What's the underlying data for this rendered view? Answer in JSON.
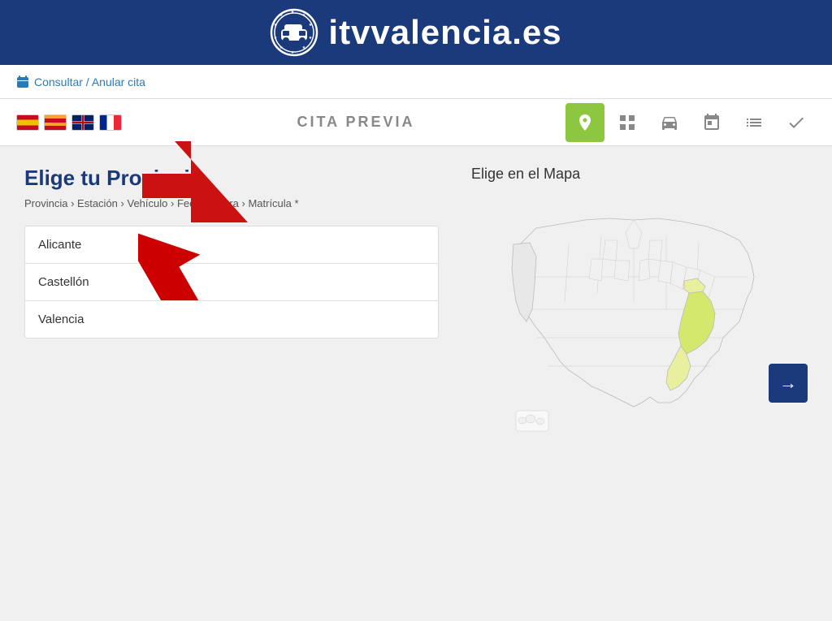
{
  "header": {
    "title": "itvvalencia.es",
    "logo_alt": "ITV car logo"
  },
  "topbar": {
    "link_text": "Consultar / Anular cita"
  },
  "navbar": {
    "title": "CITA PREVIA",
    "flags": [
      {
        "code": "es",
        "label": "Español"
      },
      {
        "code": "ca",
        "label": "Valenciano"
      },
      {
        "code": "uk",
        "label": "English"
      },
      {
        "code": "fr",
        "label": "Français"
      }
    ],
    "icons": [
      {
        "name": "location",
        "active": true
      },
      {
        "name": "grid"
      },
      {
        "name": "car"
      },
      {
        "name": "calendar"
      },
      {
        "name": "list"
      },
      {
        "name": "check"
      }
    ]
  },
  "main": {
    "title": "Elige tu Provincia",
    "breadcrumb": {
      "items": [
        "Provincia",
        "Estación",
        "Vehículo",
        "Fecha",
        "Hora",
        "Matrícula *"
      ],
      "separators": [
        ">",
        ">",
        ">",
        ">",
        ">"
      ]
    },
    "provinces": [
      {
        "name": "Alicante"
      },
      {
        "name": "Castellón"
      },
      {
        "name": "Valencia"
      }
    ],
    "next_button_label": "→",
    "map_title": "Elige en el Mapa"
  }
}
